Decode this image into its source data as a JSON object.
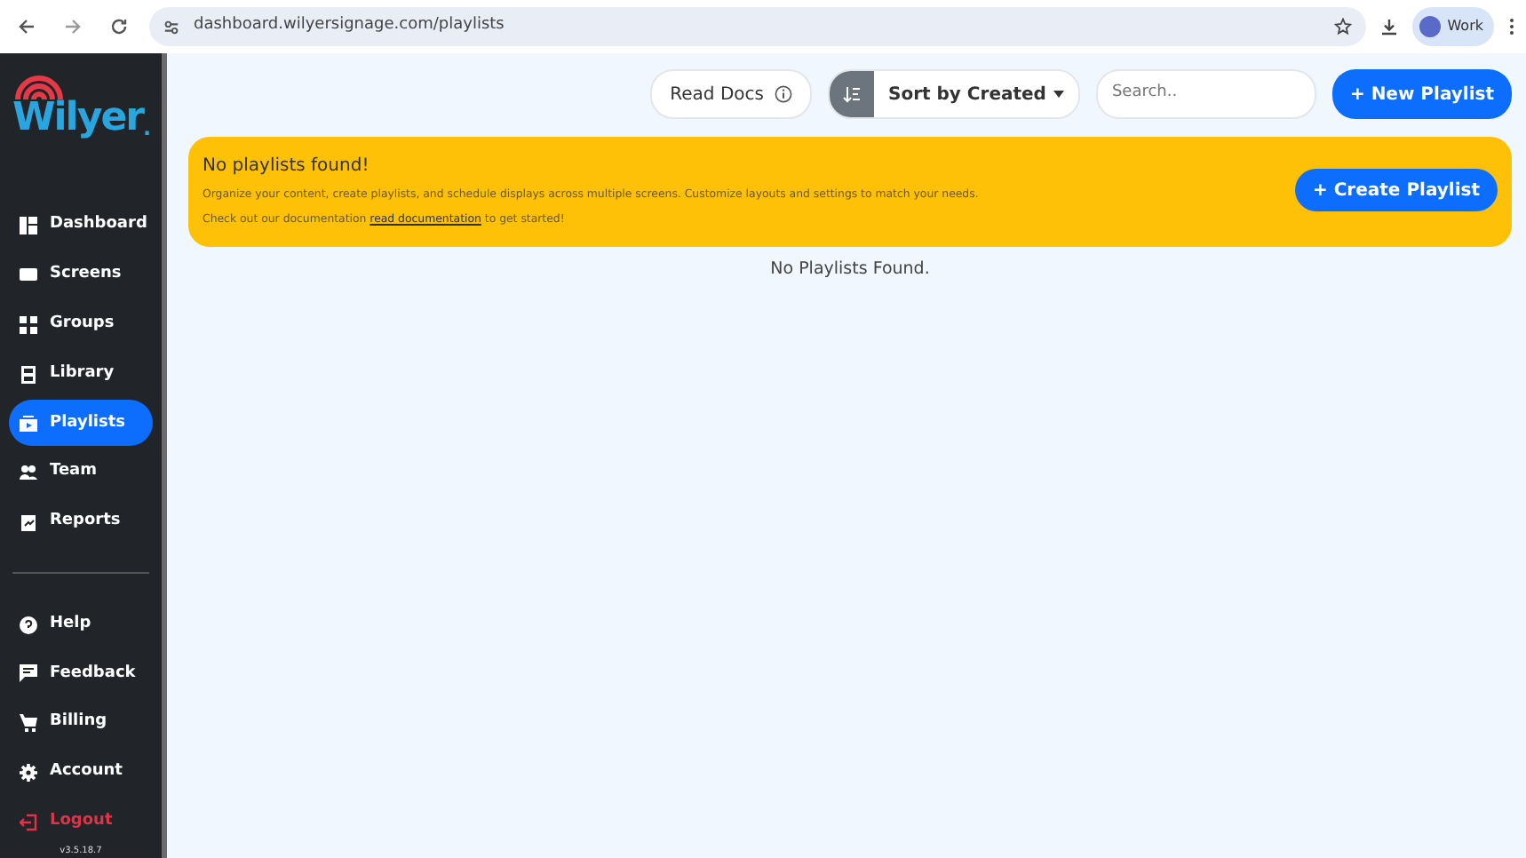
{
  "browser": {
    "url": "dashboard.wilyersignage.com/playlists",
    "profile": "Work"
  },
  "sidebar": {
    "logo": "Wilyer",
    "logo_dot": ".",
    "groups": [
      [
        {
          "label": "Dashboard",
          "selected": false,
          "kind": "nav"
        },
        {
          "label": "Screens",
          "selected": false,
          "kind": "nav"
        },
        {
          "label": "Groups",
          "selected": false,
          "kind": "nav"
        },
        {
          "label": "Library",
          "selected": false,
          "kind": "nav"
        },
        {
          "label": "Playlists",
          "selected": true,
          "kind": "nav"
        },
        {
          "label": "Team",
          "selected": false,
          "kind": "nav"
        },
        {
          "label": "Reports",
          "selected": false,
          "kind": "nav"
        }
      ],
      [
        {
          "label": "Help",
          "selected": false,
          "kind": "nav"
        },
        {
          "label": "Feedback",
          "selected": false,
          "kind": "nav"
        },
        {
          "label": "Billing",
          "selected": false,
          "kind": "nav"
        },
        {
          "label": "Account",
          "selected": false,
          "kind": "nav"
        },
        {
          "label": "Logout",
          "selected": false,
          "kind": "danger"
        }
      ]
    ],
    "version": "v3.5.18.7"
  },
  "toolbar": {
    "read_docs": "Read Docs",
    "sort": "Sort by Created",
    "search_placeholder": "Search..",
    "new_button": "+ New Playlist"
  },
  "alert": {
    "title": "No playlists found!",
    "text": "Organize your content, create playlists, and schedule displays across multiple screens. Customize layouts and settings to match your needs.",
    "doc_before": "Check out our documentation",
    "doc_link": "read documentation",
    "doc_after": "to get started!",
    "button": "+ Create Playlist"
  },
  "empty_message": "No Playlists Found."
}
